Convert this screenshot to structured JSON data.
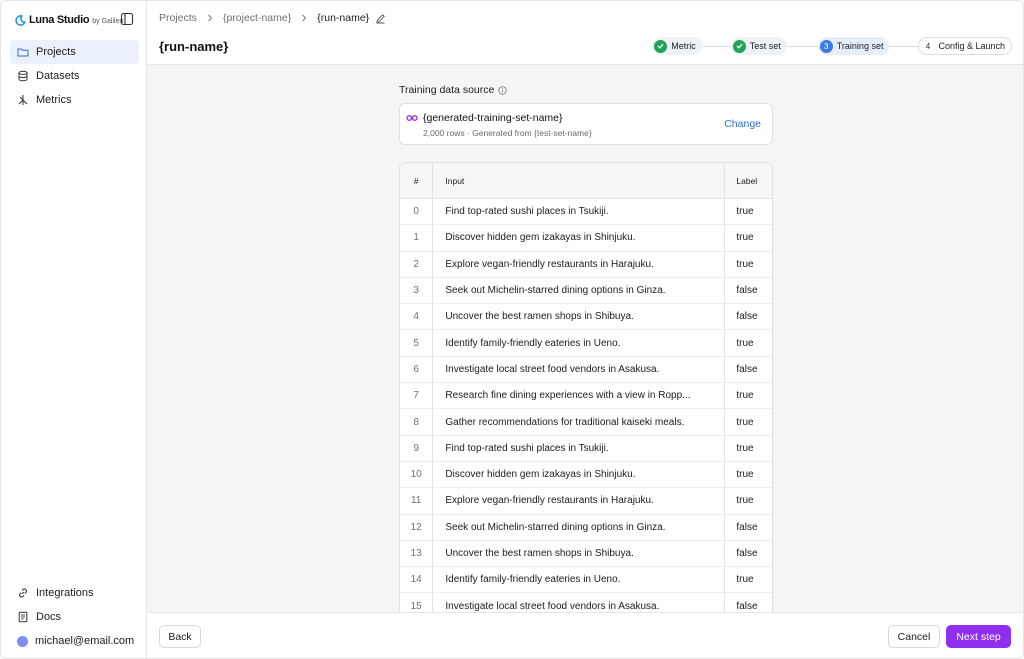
{
  "brand": {
    "name": "Luna Studio",
    "by": "by Galileo",
    "accent": "#1a8fe0"
  },
  "sidebar": {
    "items": [
      {
        "label": "Projects",
        "icon": "folder-icon",
        "active": true
      },
      {
        "label": "Datasets",
        "icon": "database-icon",
        "active": false
      },
      {
        "label": "Metrics",
        "icon": "metrics-icon",
        "active": false
      }
    ],
    "bottom": [
      {
        "label": "Integrations",
        "icon": "link-icon"
      },
      {
        "label": "Docs",
        "icon": "document-icon"
      },
      {
        "label": "michael@email.com",
        "icon": "avatar"
      }
    ]
  },
  "header": {
    "breadcrumb": [
      "Projects",
      "{project-name}",
      "{run-name}"
    ],
    "title": "{run-name}",
    "steps": [
      {
        "label": "Metric",
        "state": "done"
      },
      {
        "label": "Test set",
        "state": "done"
      },
      {
        "number": "3",
        "label": "Training set",
        "state": "current"
      },
      {
        "number": "4",
        "label": "Config & Launch",
        "state": "pending"
      }
    ]
  },
  "source": {
    "section_label": "Training data source",
    "name": "{generated-training-set-name}",
    "meta": "2,000 rows · Generated from {test-set-name}",
    "change_label": "Change"
  },
  "table": {
    "columns": [
      "#",
      "Input",
      "Label"
    ],
    "rows": [
      [
        "0",
        "Find top-rated sushi places in Tsukiji.",
        "true"
      ],
      [
        "1",
        "Discover hidden gem izakayas in Shinjuku.",
        "true"
      ],
      [
        "2",
        "Explore vegan-friendly restaurants in Harajuku.",
        "true"
      ],
      [
        "3",
        "Seek out Michelin-starred dining options in Ginza.",
        "false"
      ],
      [
        "4",
        "Uncover the best ramen shops in Shibuya.",
        "false"
      ],
      [
        "5",
        "Identify family-friendly eateries in Ueno.",
        "true"
      ],
      [
        "6",
        "Investigate local street food vendors in Asakusa.",
        "false"
      ],
      [
        "7",
        "Research fine dining experiences with a view in Ropp...",
        "true"
      ],
      [
        "8",
        "Gather recommendations for traditional kaiseki meals.",
        "true"
      ],
      [
        "9",
        "Find top-rated sushi places in Tsukiji.",
        "true"
      ],
      [
        "10",
        "Discover hidden gem izakayas in Shinjuku.",
        "true"
      ],
      [
        "11",
        "Explore vegan-friendly restaurants in Harajuku.",
        "true"
      ],
      [
        "12",
        "Seek out Michelin-starred dining options in Ginza.",
        "false"
      ],
      [
        "13",
        "Uncover the best ramen shops in Shibuya.",
        "false"
      ],
      [
        "14",
        "Identify family-friendly eateries in Ueno.",
        "true"
      ],
      [
        "15",
        "Investigate local street food vendors in Asakusa.",
        "false"
      ]
    ]
  },
  "footer": {
    "back_label": "Back",
    "cancel_label": "Cancel",
    "next_label": "Next step",
    "next_color": "#8f2ff0"
  }
}
